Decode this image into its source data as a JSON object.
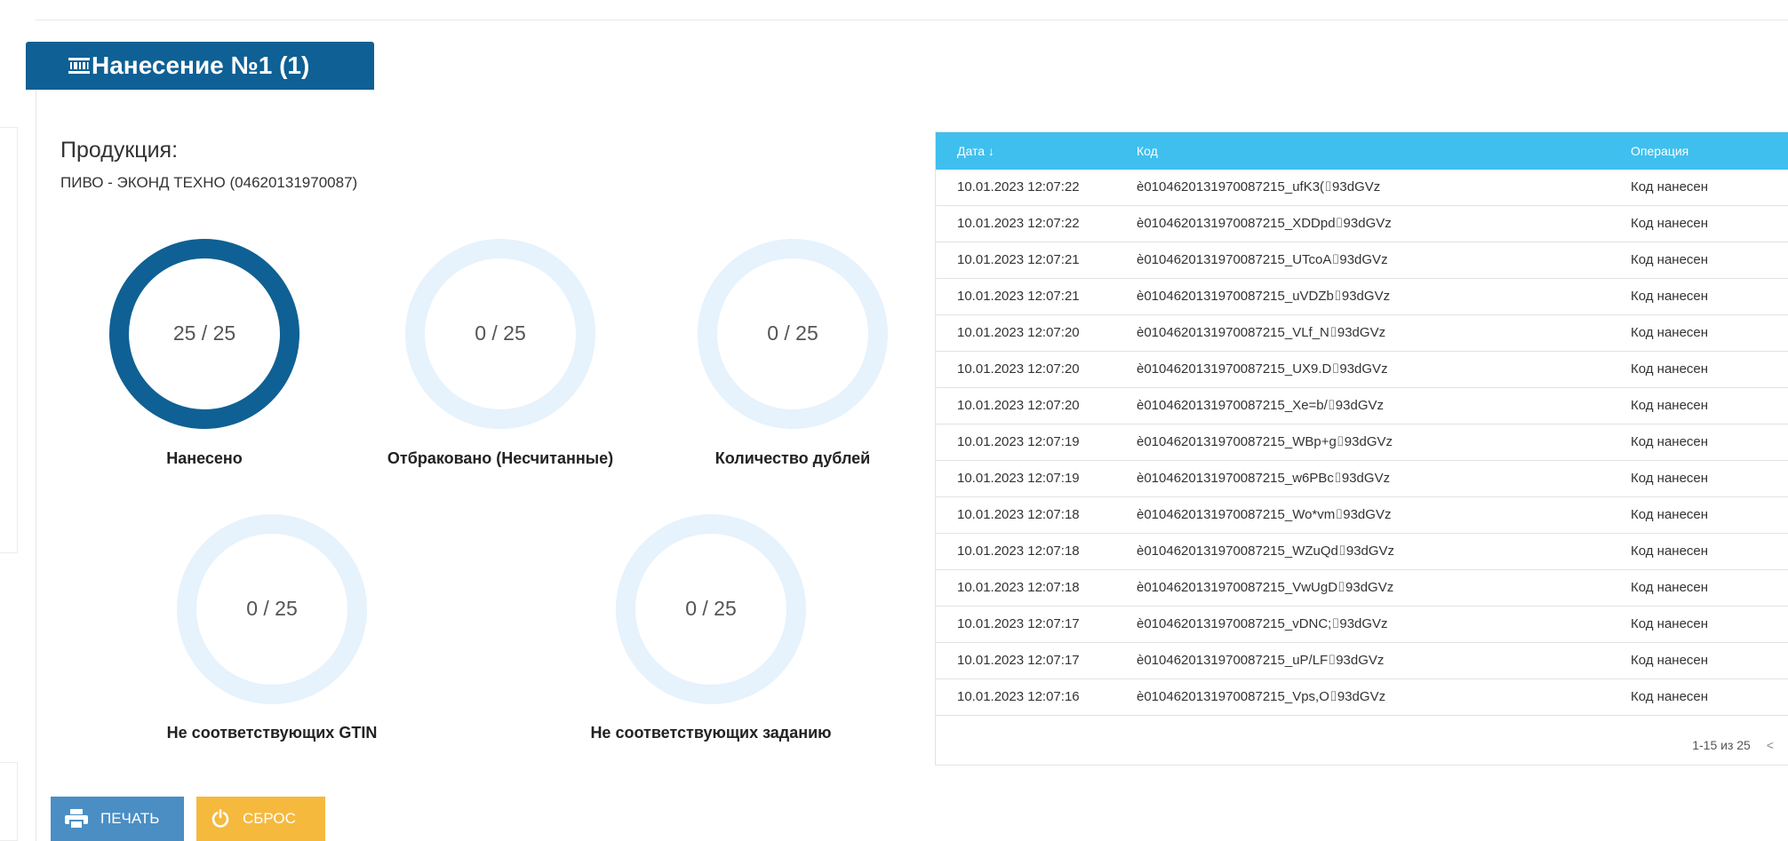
{
  "header": {
    "title": "Нанесение №1 (1)",
    "icon": "barcode-icon"
  },
  "product": {
    "label": "Продукция:",
    "name": "ПИВО - ЭКОНД ТЕХНО (04620131970087)"
  },
  "gauges": [
    {
      "value_text": "25 / 25",
      "label": "Нанесено",
      "current": 25,
      "total": 25,
      "fill_color": "#0f6094",
      "track_color": "#e6f2fc"
    },
    {
      "value_text": "0 / 25",
      "label": "Отбраковано (Несчитанные)",
      "current": 0,
      "total": 25,
      "fill_color": "#0f6094",
      "track_color": "#e6f2fc"
    },
    {
      "value_text": "0 / 25",
      "label": "Количество дублей",
      "current": 0,
      "total": 25,
      "fill_color": "#0f6094",
      "track_color": "#e6f2fc"
    },
    {
      "value_text": "0 / 25",
      "label": "Не соответствующих GTIN",
      "current": 0,
      "total": 25,
      "fill_color": "#0f6094",
      "track_color": "#e6f2fc"
    },
    {
      "value_text": "0 / 25",
      "label": "Не соответствующих заданию",
      "current": 0,
      "total": 25,
      "fill_color": "#0f6094",
      "track_color": "#e6f2fc"
    }
  ],
  "table": {
    "columns": {
      "date": "Дата ↓",
      "code": "Код",
      "operation": "Операция"
    },
    "rows": [
      {
        "date": "10.01.2023 12:07:22",
        "code": "è0104620131970087215_ufK3(⌷93dGVz",
        "operation": "Код нанесен"
      },
      {
        "date": "10.01.2023 12:07:22",
        "code": "è0104620131970087215_XDDpd⌷93dGVz",
        "operation": "Код нанесен"
      },
      {
        "date": "10.01.2023 12:07:21",
        "code": "è0104620131970087215_UTcoA⌷93dGVz",
        "operation": "Код нанесен"
      },
      {
        "date": "10.01.2023 12:07:21",
        "code": "è0104620131970087215_uVDZb⌷93dGVz",
        "operation": "Код нанесен"
      },
      {
        "date": "10.01.2023 12:07:20",
        "code": "è0104620131970087215_VLf_N⌷93dGVz",
        "operation": "Код нанесен"
      },
      {
        "date": "10.01.2023 12:07:20",
        "code": "è0104620131970087215_UX9.D⌷93dGVz",
        "operation": "Код нанесен"
      },
      {
        "date": "10.01.2023 12:07:20",
        "code": "è0104620131970087215_Xe=b/⌷93dGVz",
        "operation": "Код нанесен"
      },
      {
        "date": "10.01.2023 12:07:19",
        "code": "è0104620131970087215_WBp+g⌷93dGVz",
        "operation": "Код нанесен"
      },
      {
        "date": "10.01.2023 12:07:19",
        "code": "è0104620131970087215_w6PBc⌷93dGVz",
        "operation": "Код нанесен"
      },
      {
        "date": "10.01.2023 12:07:18",
        "code": "è0104620131970087215_Wo*vm⌷93dGVz",
        "operation": "Код нанесен"
      },
      {
        "date": "10.01.2023 12:07:18",
        "code": "è0104620131970087215_WZuQd⌷93dGVz",
        "operation": "Код нанесен"
      },
      {
        "date": "10.01.2023 12:07:18",
        "code": "è0104620131970087215_VwUgD⌷93dGVz",
        "operation": "Код нанесен"
      },
      {
        "date": "10.01.2023 12:07:17",
        "code": "è0104620131970087215_vDNC;⌷93dGVz",
        "operation": "Код нанесен"
      },
      {
        "date": "10.01.2023 12:07:17",
        "code": "è0104620131970087215_uP/LF⌷93dGVz",
        "operation": "Код нанесен"
      },
      {
        "date": "10.01.2023 12:07:16",
        "code": "è0104620131970087215_Vps,O⌷93dGVz",
        "operation": "Код нанесен"
      }
    ],
    "pager": {
      "range": "1-15 из 25",
      "prev": "<",
      "next": ">"
    },
    "header_color": "#3fbfee"
  },
  "buttons": {
    "print": {
      "label": "ПЕЧАТЬ",
      "icon": "printer-icon",
      "color": "#4a8ec4"
    },
    "reset": {
      "label": "СБРОС",
      "icon": "power-icon",
      "color": "#f5b93d"
    }
  }
}
